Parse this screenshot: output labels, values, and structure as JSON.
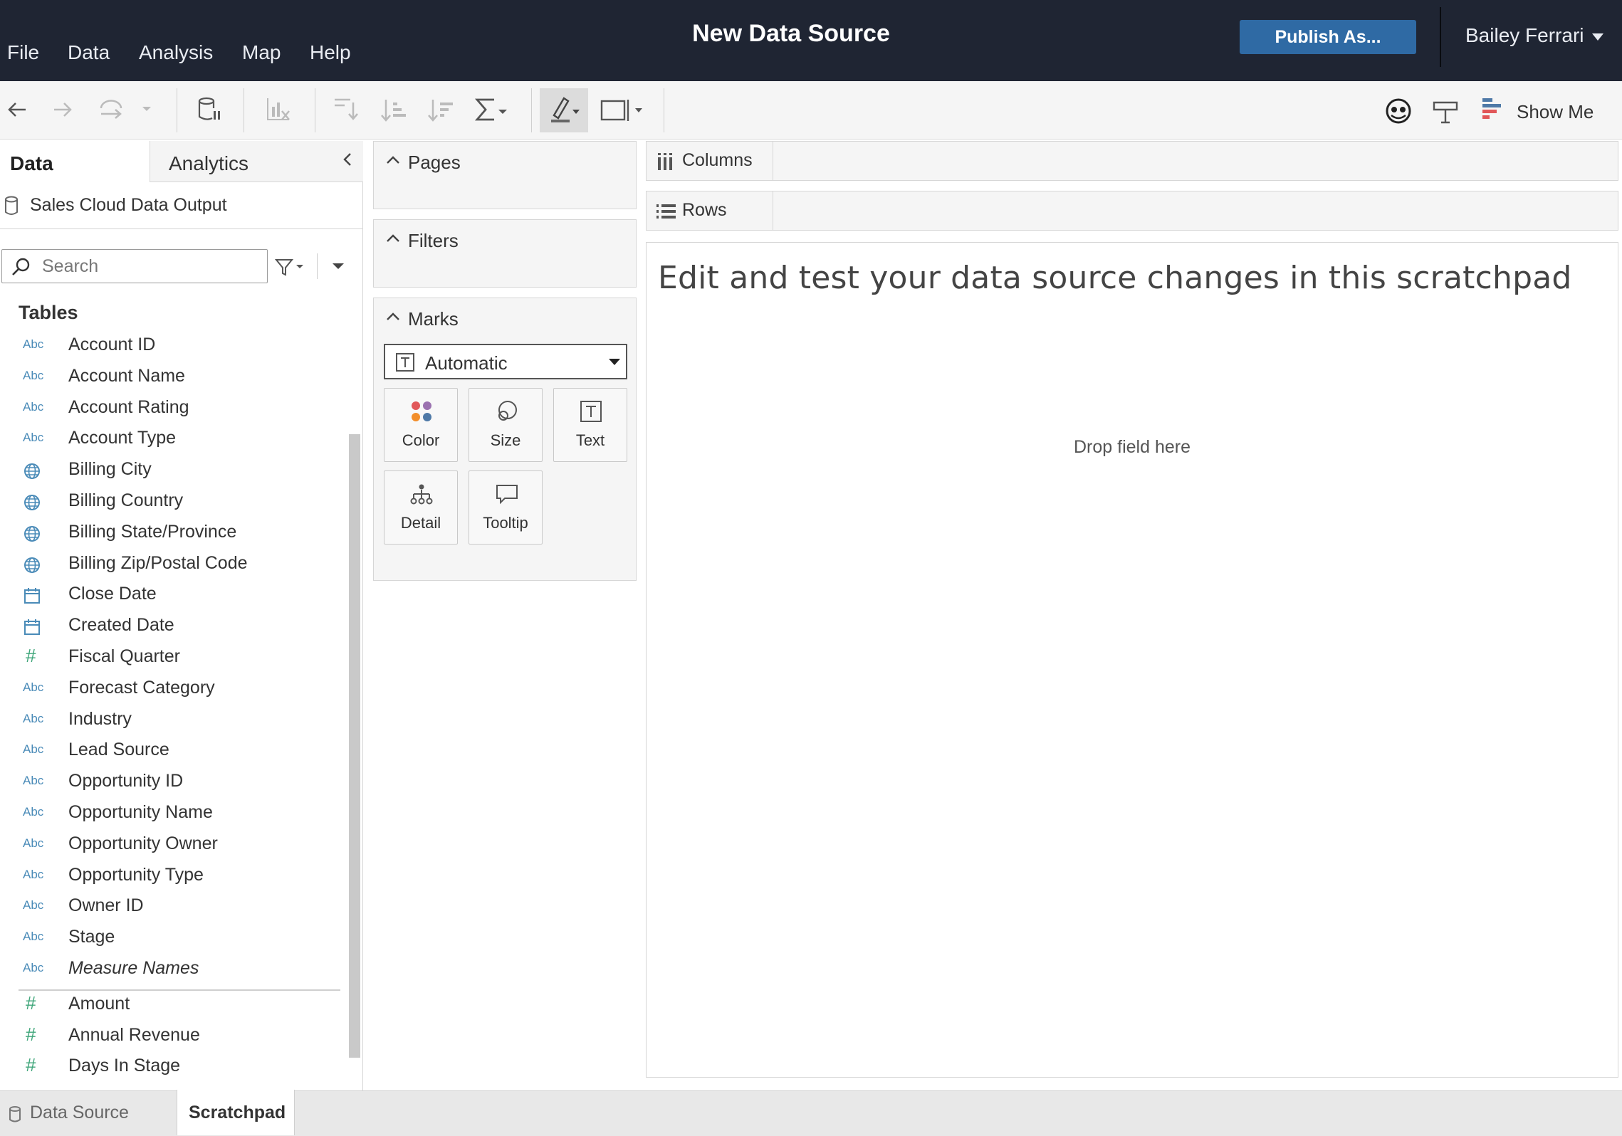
{
  "menu": [
    "File",
    "Data",
    "Analysis",
    "Map",
    "Help"
  ],
  "app": {
    "title": "New Data Source"
  },
  "header": {
    "publish_label": "Publish As...",
    "user_name": "Bailey Ferrari"
  },
  "toolbar": {
    "show_me_label": "Show Me"
  },
  "data_pane": {
    "tabs": {
      "data": "Data",
      "analytics": "Analytics"
    },
    "data_source_name": "Sales Cloud Data Output",
    "search": {
      "placeholder": "Search",
      "value": ""
    },
    "tables_heading": "Tables",
    "dimensions": [
      {
        "type": "Abc",
        "label": "Account ID"
      },
      {
        "type": "Abc",
        "label": "Account Name"
      },
      {
        "type": "Abc",
        "label": "Account Rating"
      },
      {
        "type": "Abc",
        "label": "Account Type"
      },
      {
        "type": "geo",
        "label": "Billing City"
      },
      {
        "type": "geo",
        "label": "Billing Country"
      },
      {
        "type": "geo",
        "label": "Billing State/Province"
      },
      {
        "type": "geo",
        "label": "Billing Zip/Postal Code"
      },
      {
        "type": "date",
        "label": "Close Date"
      },
      {
        "type": "date",
        "label": "Created Date"
      },
      {
        "type": "number",
        "label": "Fiscal Quarter"
      },
      {
        "type": "Abc",
        "label": "Forecast Category"
      },
      {
        "type": "Abc",
        "label": "Industry"
      },
      {
        "type": "Abc",
        "label": "Lead Source"
      },
      {
        "type": "Abc",
        "label": "Opportunity ID"
      },
      {
        "type": "Abc",
        "label": "Opportunity Name"
      },
      {
        "type": "Abc",
        "label": "Opportunity Owner"
      },
      {
        "type": "Abc",
        "label": "Opportunity Type"
      },
      {
        "type": "Abc",
        "label": "Owner ID"
      },
      {
        "type": "Abc",
        "label": "Stage"
      },
      {
        "type": "Abc",
        "label": "Measure Names"
      }
    ],
    "measures": [
      {
        "type": "number",
        "label": "Amount"
      },
      {
        "type": "number",
        "label": "Annual Revenue"
      },
      {
        "type": "number",
        "label": "Days In Stage"
      }
    ],
    "type_glyphs": {
      "Abc": "Abc",
      "number": "#"
    }
  },
  "cards": {
    "pages": "Pages",
    "filters": "Filters",
    "marks": {
      "title": "Marks",
      "mark_type": "Automatic",
      "buttons": [
        "Color",
        "Size",
        "Text",
        "Detail",
        "Tooltip"
      ]
    }
  },
  "shelves": {
    "columns": "Columns",
    "rows": "Rows"
  },
  "canvas": {
    "title": "Edit and test your data source changes in this scratchpad",
    "drop_hint": "Drop field here"
  },
  "bottom_tabs": {
    "data_source": "Data Source",
    "scratchpad": "Scratchpad"
  },
  "colors": {
    "topbar": "#1f2533",
    "publish_button": "#2f6aa4",
    "string_icon": "#4a8bb8",
    "number_icon": "#3fa67a"
  }
}
